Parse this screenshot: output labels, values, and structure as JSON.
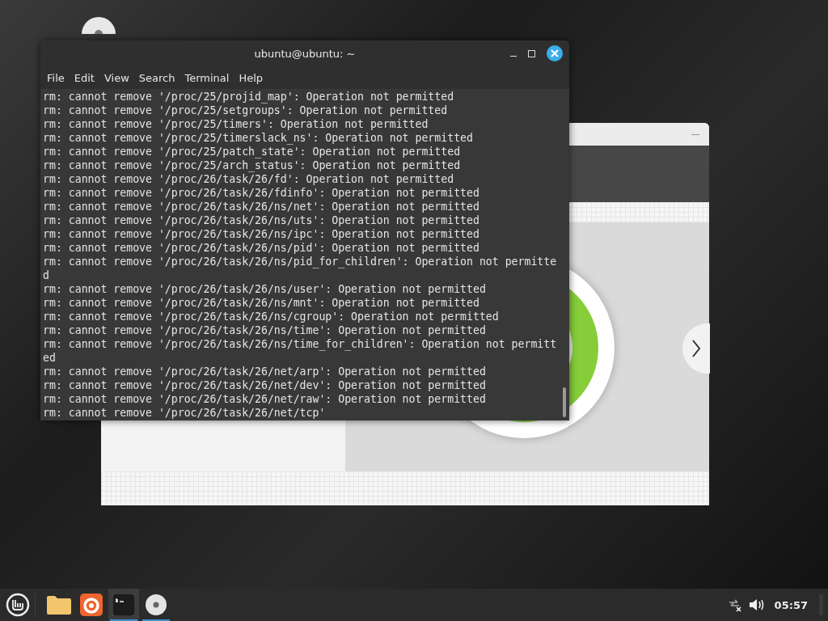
{
  "terminal": {
    "title": "ubuntu@ubuntu: ~",
    "menu": [
      "File",
      "Edit",
      "View",
      "Search",
      "Terminal",
      "Help"
    ],
    "lines": [
      "rm: cannot remove '/proc/25/projid_map': Operation not permitted",
      "rm: cannot remove '/proc/25/setgroups': Operation not permitted",
      "rm: cannot remove '/proc/25/timers': Operation not permitted",
      "rm: cannot remove '/proc/25/timerslack_ns': Operation not permitted",
      "rm: cannot remove '/proc/25/patch_state': Operation not permitted",
      "rm: cannot remove '/proc/25/arch_status': Operation not permitted",
      "rm: cannot remove '/proc/26/task/26/fd': Operation not permitted",
      "rm: cannot remove '/proc/26/task/26/fdinfo': Operation not permitted",
      "rm: cannot remove '/proc/26/task/26/ns/net': Operation not permitted",
      "rm: cannot remove '/proc/26/task/26/ns/uts': Operation not permitted",
      "rm: cannot remove '/proc/26/task/26/ns/ipc': Operation not permitted",
      "rm: cannot remove '/proc/26/task/26/ns/pid': Operation not permitted",
      "rm: cannot remove '/proc/26/task/26/ns/pid_for_children': Operation not permitte",
      "d",
      "rm: cannot remove '/proc/26/task/26/ns/user': Operation not permitted",
      "rm: cannot remove '/proc/26/task/26/ns/mnt': Operation not permitted",
      "rm: cannot remove '/proc/26/task/26/ns/cgroup': Operation not permitted",
      "rm: cannot remove '/proc/26/task/26/ns/time': Operation not permitted",
      "rm: cannot remove '/proc/26/task/26/ns/time_for_children': Operation not permitt",
      "ed",
      "rm: cannot remove '/proc/26/task/26/net/arp': Operation not permitted",
      "rm: cannot remove '/proc/26/task/26/net/dev': Operation not permitted",
      "rm: cannot remove '/proc/26/task/26/net/raw': Operation not permitted",
      "rm: cannot remove '/proc/26/task/26/net/tcp'"
    ]
  },
  "taskbar": {
    "launchers": [
      {
        "kind": "folder",
        "selected": false,
        "running": false
      },
      {
        "kind": "browser",
        "selected": false,
        "running": false
      },
      {
        "kind": "terminal",
        "selected": true,
        "running": true
      },
      {
        "kind": "disc",
        "selected": false,
        "running": true
      }
    ],
    "clock": "05:57"
  }
}
